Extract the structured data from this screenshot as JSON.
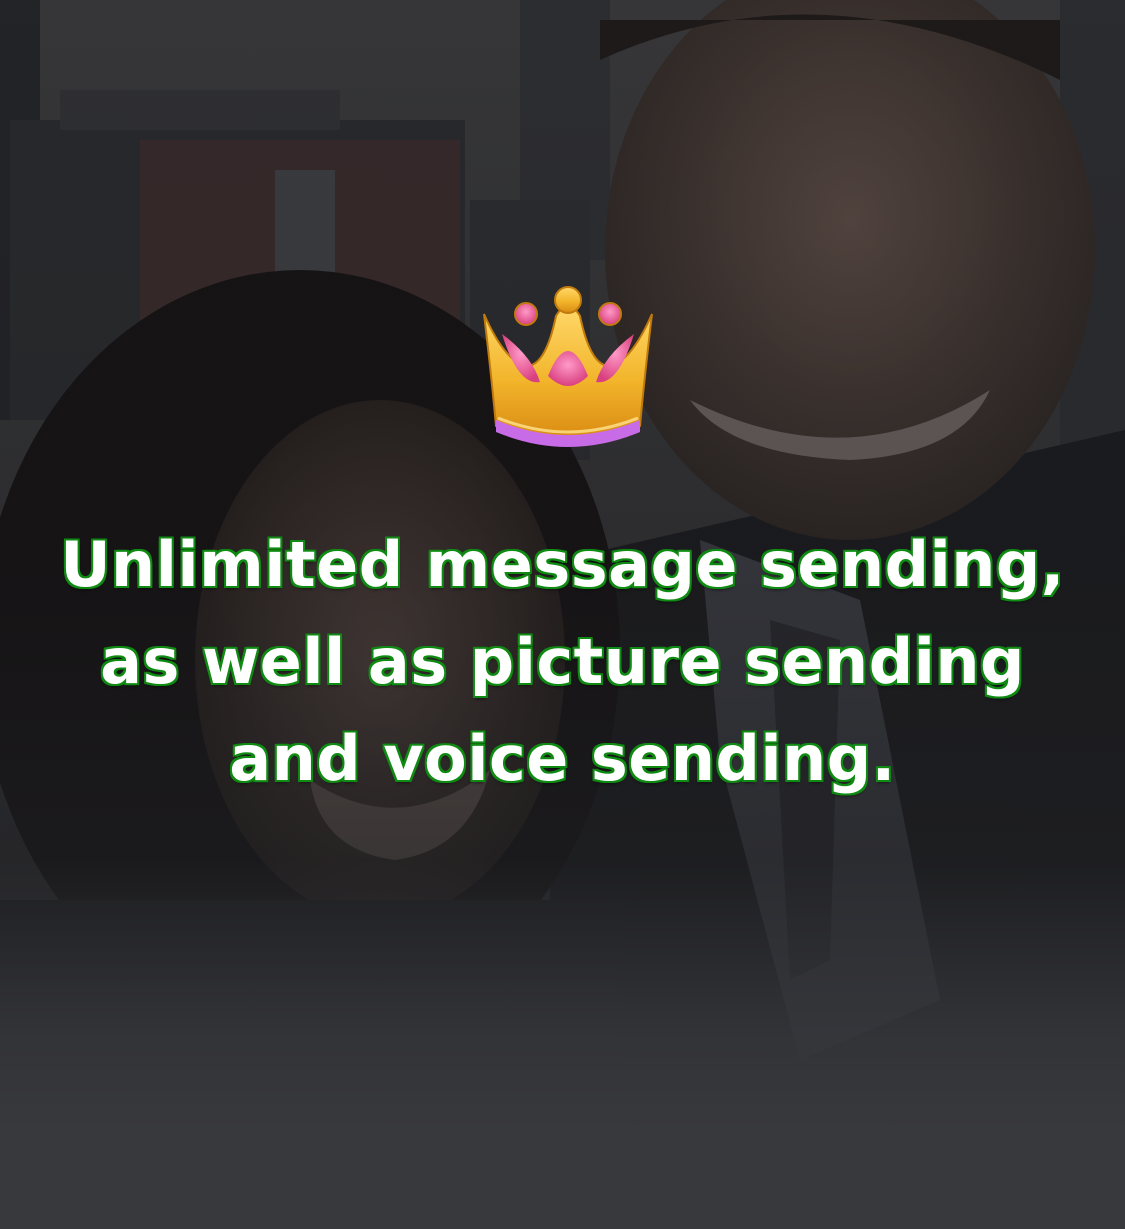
{
  "promo": {
    "icon": "crown-icon",
    "headline": "Unlimited message sending, as well as picture sending and voice sending."
  },
  "colors": {
    "text": "#ffffff",
    "text_outline": "#0f8a12",
    "background_bottom": "#38393d",
    "crown_gold": "#f2b52b",
    "crown_pink": "#e9559a",
    "crown_band": "#c86be6"
  }
}
